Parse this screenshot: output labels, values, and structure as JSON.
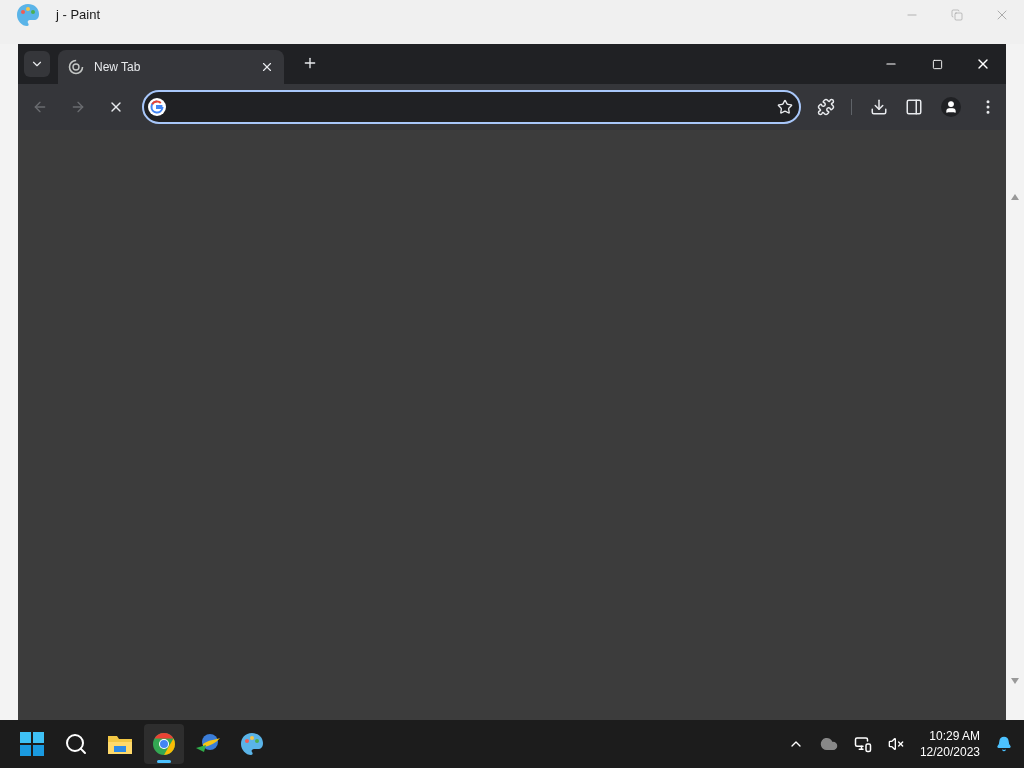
{
  "paint_window": {
    "title": "j - Paint"
  },
  "browser": {
    "tabs": [
      {
        "title": "New Tab",
        "selected": true
      }
    ],
    "omnibox": {
      "focused": true
    }
  },
  "taskbar": {
    "apps": [
      {
        "kind": "start",
        "selected": false
      },
      {
        "kind": "search",
        "selected": false
      },
      {
        "kind": "files",
        "selected": false
      },
      {
        "kind": "chrome",
        "selected": true
      },
      {
        "kind": "downloader",
        "selected": false
      },
      {
        "kind": "paint",
        "selected": false
      }
    ],
    "clock": {
      "time": "10:29 AM",
      "date": "12/20/2023"
    }
  }
}
